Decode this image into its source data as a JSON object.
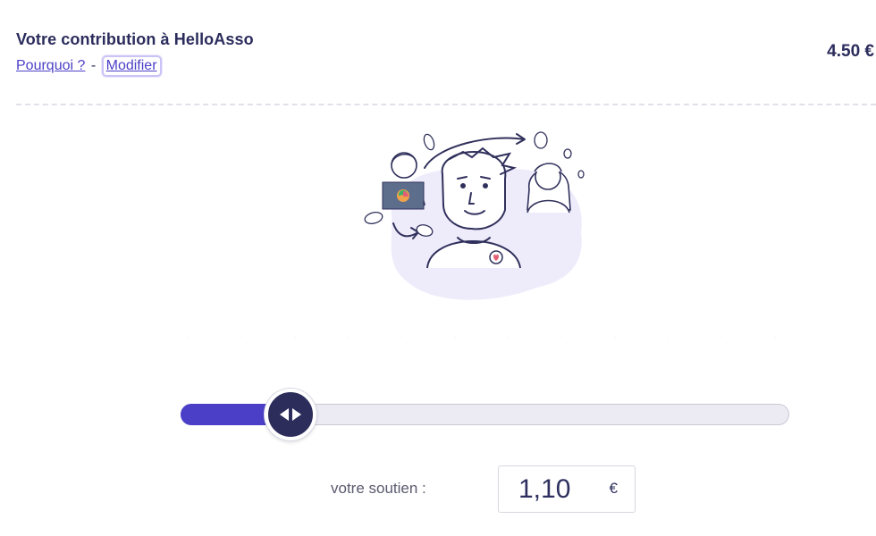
{
  "header": {
    "title": "Votre contribution à HelloAsso",
    "why_link": "Pourquoi ?",
    "separator": "-",
    "modify_link": "Modifier",
    "amount": "4.50 €"
  },
  "support": {
    "label": "votre soutien :",
    "value": "1,10",
    "currency": "€",
    "slider_fraction": 0.18
  },
  "colors": {
    "accent": "#4b3fc7",
    "thumb": "#2d2d5c",
    "text": "#2b2c5c"
  },
  "icons": {
    "thumb": "left-right-arrows-icon",
    "illustration": "donor-illustration"
  }
}
